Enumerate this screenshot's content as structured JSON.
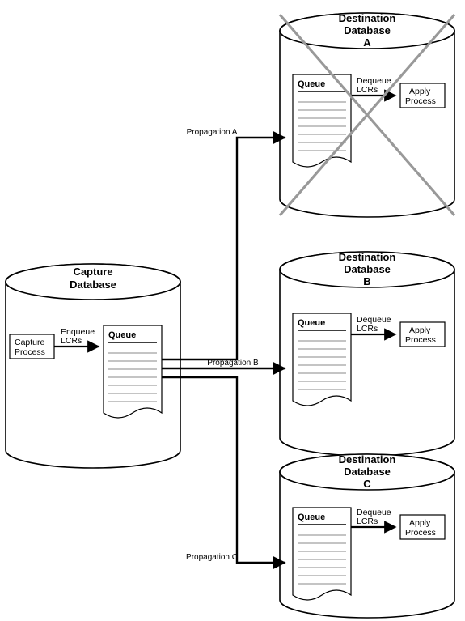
{
  "source": {
    "title_l1": "Capture",
    "title_l2": "Database",
    "process_l1": "Capture",
    "process_l2": "Process",
    "flow_l1": "Enqueue",
    "flow_l2": "LCRs",
    "queue_label": "Queue"
  },
  "destinations": [
    {
      "title_l1": "Destination",
      "title_l2": "Database",
      "title_l3": "A",
      "queue_label": "Queue",
      "flow_l1": "Dequeue",
      "flow_l2": "LCRs",
      "process_l1": "Apply",
      "process_l2": "Process",
      "propagation_label": "Propagation A",
      "crossed_out": true
    },
    {
      "title_l1": "Destination",
      "title_l2": "Database",
      "title_l3": "B",
      "queue_label": "Queue",
      "flow_l1": "Dequeue",
      "flow_l2": "LCRs",
      "process_l1": "Apply",
      "process_l2": "Process",
      "propagation_label": "Propagation B",
      "crossed_out": false
    },
    {
      "title_l1": "Destination",
      "title_l2": "Database",
      "title_l3": "C",
      "queue_label": "Queue",
      "flow_l1": "Dequeue",
      "flow_l2": "LCRs",
      "process_l1": "Apply",
      "process_l2": "Process",
      "propagation_label": "Propagation C",
      "crossed_out": false
    }
  ],
  "chart_data": {
    "type": "diagram",
    "title": "Database replication with one unavailable destination",
    "nodes": [
      {
        "id": "capture_db",
        "label": "Capture Database",
        "contains": [
          "capture_process",
          "capture_queue"
        ]
      },
      {
        "id": "capture_process",
        "label": "Capture Process"
      },
      {
        "id": "capture_queue",
        "label": "Queue"
      },
      {
        "id": "dest_a",
        "label": "Destination Database A",
        "status": "unavailable",
        "contains": [
          "queue_a",
          "apply_a"
        ]
      },
      {
        "id": "queue_a",
        "label": "Queue"
      },
      {
        "id": "apply_a",
        "label": "Apply Process"
      },
      {
        "id": "dest_b",
        "label": "Destination Database B",
        "contains": [
          "queue_b",
          "apply_b"
        ]
      },
      {
        "id": "queue_b",
        "label": "Queue"
      },
      {
        "id": "apply_b",
        "label": "Apply Process"
      },
      {
        "id": "dest_c",
        "label": "Destination Database C",
        "contains": [
          "queue_c",
          "apply_c"
        ]
      },
      {
        "id": "queue_c",
        "label": "Queue"
      },
      {
        "id": "apply_c",
        "label": "Apply Process"
      }
    ],
    "edges": [
      {
        "from": "capture_process",
        "to": "capture_queue",
        "label": "Enqueue LCRs"
      },
      {
        "from": "capture_queue",
        "to": "queue_a",
        "label": "Propagation A"
      },
      {
        "from": "capture_queue",
        "to": "queue_b",
        "label": "Propagation B"
      },
      {
        "from": "capture_queue",
        "to": "queue_c",
        "label": "Propagation C"
      },
      {
        "from": "queue_a",
        "to": "apply_a",
        "label": "Dequeue LCRs"
      },
      {
        "from": "queue_b",
        "to": "apply_b",
        "label": "Dequeue LCRs"
      },
      {
        "from": "queue_c",
        "to": "apply_c",
        "label": "Dequeue LCRs"
      }
    ]
  }
}
